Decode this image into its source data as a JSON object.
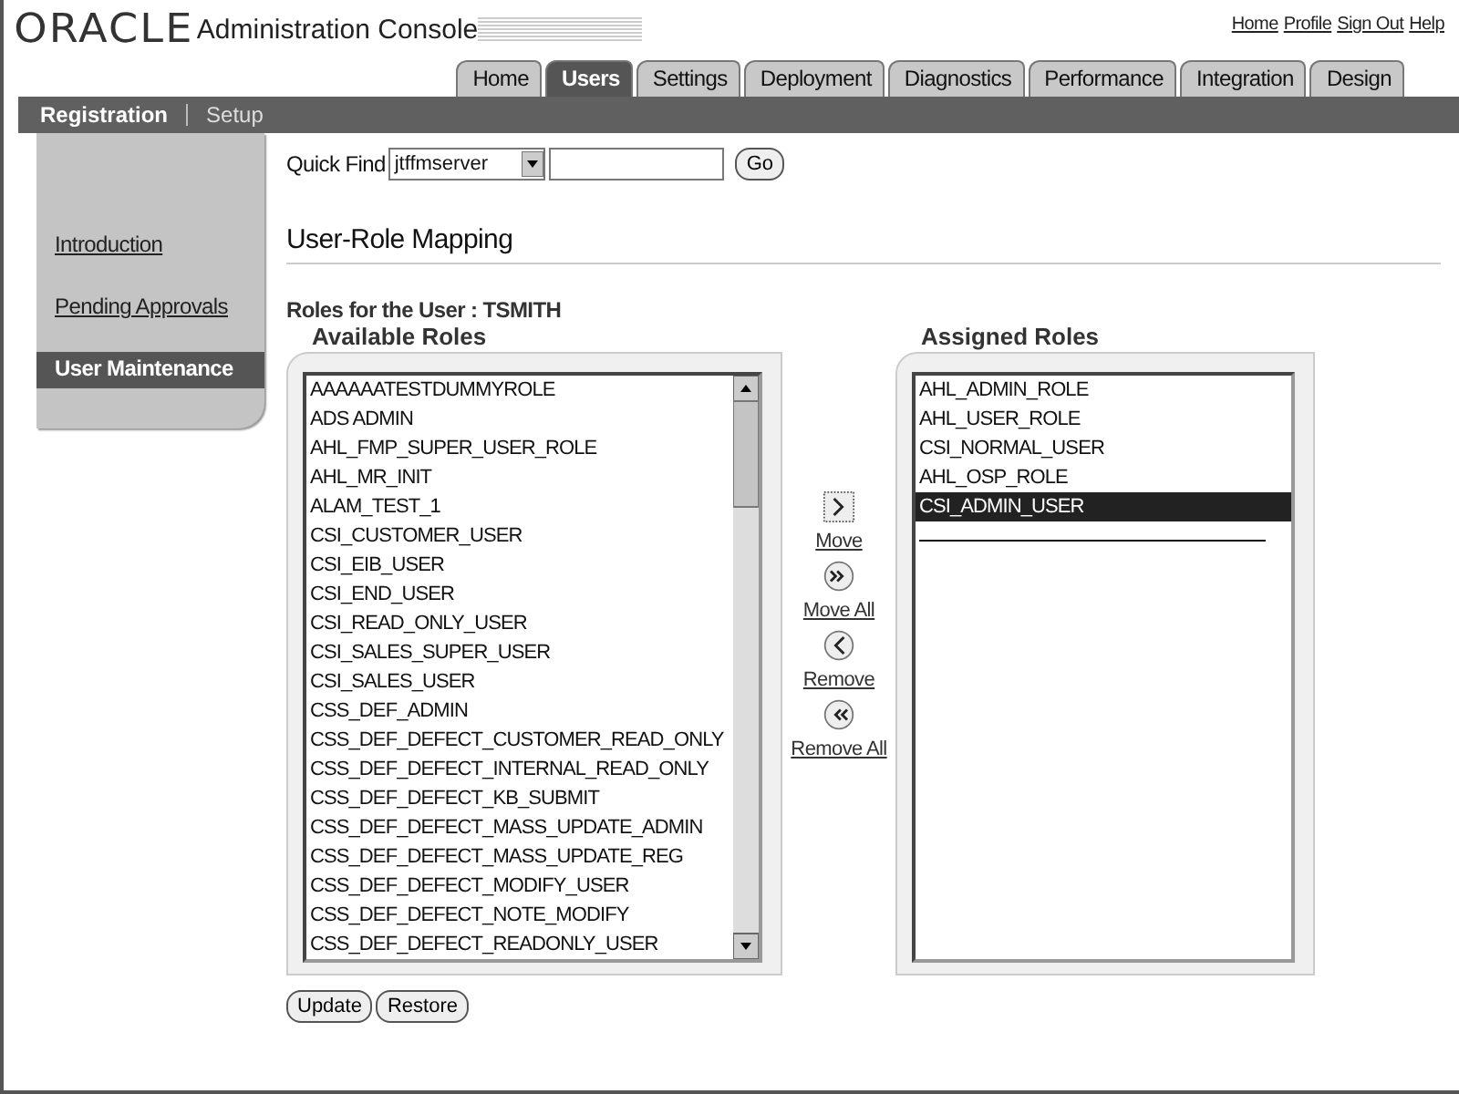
{
  "header": {
    "logo": "ORACLE",
    "title": "Administration Console",
    "links": [
      "Home",
      "Profile",
      "Sign Out",
      "Help"
    ]
  },
  "tabs": [
    {
      "label": "Home",
      "selected": false
    },
    {
      "label": "Users",
      "selected": true
    },
    {
      "label": "Settings",
      "selected": false
    },
    {
      "label": "Deployment",
      "selected": false
    },
    {
      "label": "Diagnostics",
      "selected": false
    },
    {
      "label": "Performance",
      "selected": false
    },
    {
      "label": "Integration",
      "selected": false
    },
    {
      "label": "Design",
      "selected": false
    }
  ],
  "subnav": [
    {
      "label": "Registration",
      "selected": true
    },
    {
      "label": "Setup",
      "selected": false
    }
  ],
  "sidebar": {
    "items": [
      {
        "label": "Introduction",
        "selected": false
      },
      {
        "label": "Pending Approvals",
        "selected": false
      },
      {
        "label": "User Maintenance",
        "selected": true
      }
    ]
  },
  "quick_find": {
    "label": "Quick Find",
    "select_value": "jtffmserver",
    "button": "Go"
  },
  "section_title": "User-Role Mapping",
  "user_label": "Roles for the User : TSMITH",
  "available": {
    "title": "Available Roles",
    "items": [
      {
        "label": "AAAAAATESTDUMMYROLE",
        "selected": false
      },
      {
        "label": "ADS ADMIN",
        "selected": false
      },
      {
        "label": "AHL_FMP_SUPER_USER_ROLE",
        "selected": false
      },
      {
        "label": "AHL_MR_INIT",
        "selected": false
      },
      {
        "label": "ALAM_TEST_1",
        "selected": false
      },
      {
        "label": "CSI_CUSTOMER_USER",
        "selected": false
      },
      {
        "label": "CSI_EIB_USER",
        "selected": false
      },
      {
        "label": "CSI_END_USER",
        "selected": false
      },
      {
        "label": "CSI_READ_ONLY_USER",
        "selected": false
      },
      {
        "label": "CSI_SALES_SUPER_USER",
        "selected": false
      },
      {
        "label": "CSI_SALES_USER",
        "selected": false
      },
      {
        "label": "CSS_DEF_ADMIN",
        "selected": false
      },
      {
        "label": "CSS_DEF_DEFECT_CUSTOMER_READ_ONLY",
        "selected": false
      },
      {
        "label": "CSS_DEF_DEFECT_INTERNAL_READ_ONLY",
        "selected": false
      },
      {
        "label": "CSS_DEF_DEFECT_KB_SUBMIT",
        "selected": false
      },
      {
        "label": "CSS_DEF_DEFECT_MASS_UPDATE_ADMIN",
        "selected": false
      },
      {
        "label": "CSS_DEF_DEFECT_MASS_UPDATE_REG",
        "selected": false
      },
      {
        "label": "CSS_DEF_DEFECT_MODIFY_USER",
        "selected": false
      },
      {
        "label": "CSS_DEF_DEFECT_NOTE_MODIFY",
        "selected": false
      },
      {
        "label": "CSS_DEF_DEFECT_READONLY_USER",
        "selected": false
      }
    ]
  },
  "shuttle": [
    {
      "kind": "move",
      "label": "Move"
    },
    {
      "kind": "move_all",
      "label": "Move All"
    },
    {
      "kind": "remove",
      "label": "Remove"
    },
    {
      "kind": "remove_all",
      "label": "Remove All"
    }
  ],
  "assigned": {
    "title": "Assigned Roles",
    "items": [
      {
        "label": "AHL_ADMIN_ROLE",
        "selected": false
      },
      {
        "label": "AHL_USER_ROLE",
        "selected": false
      },
      {
        "label": "CSI_NORMAL_USER",
        "selected": false
      },
      {
        "label": "AHL_OSP_ROLE",
        "selected": false
      },
      {
        "label": "CSI_ADMIN_USER",
        "selected": true
      }
    ]
  },
  "buttons": [
    "Update",
    "Restore"
  ]
}
